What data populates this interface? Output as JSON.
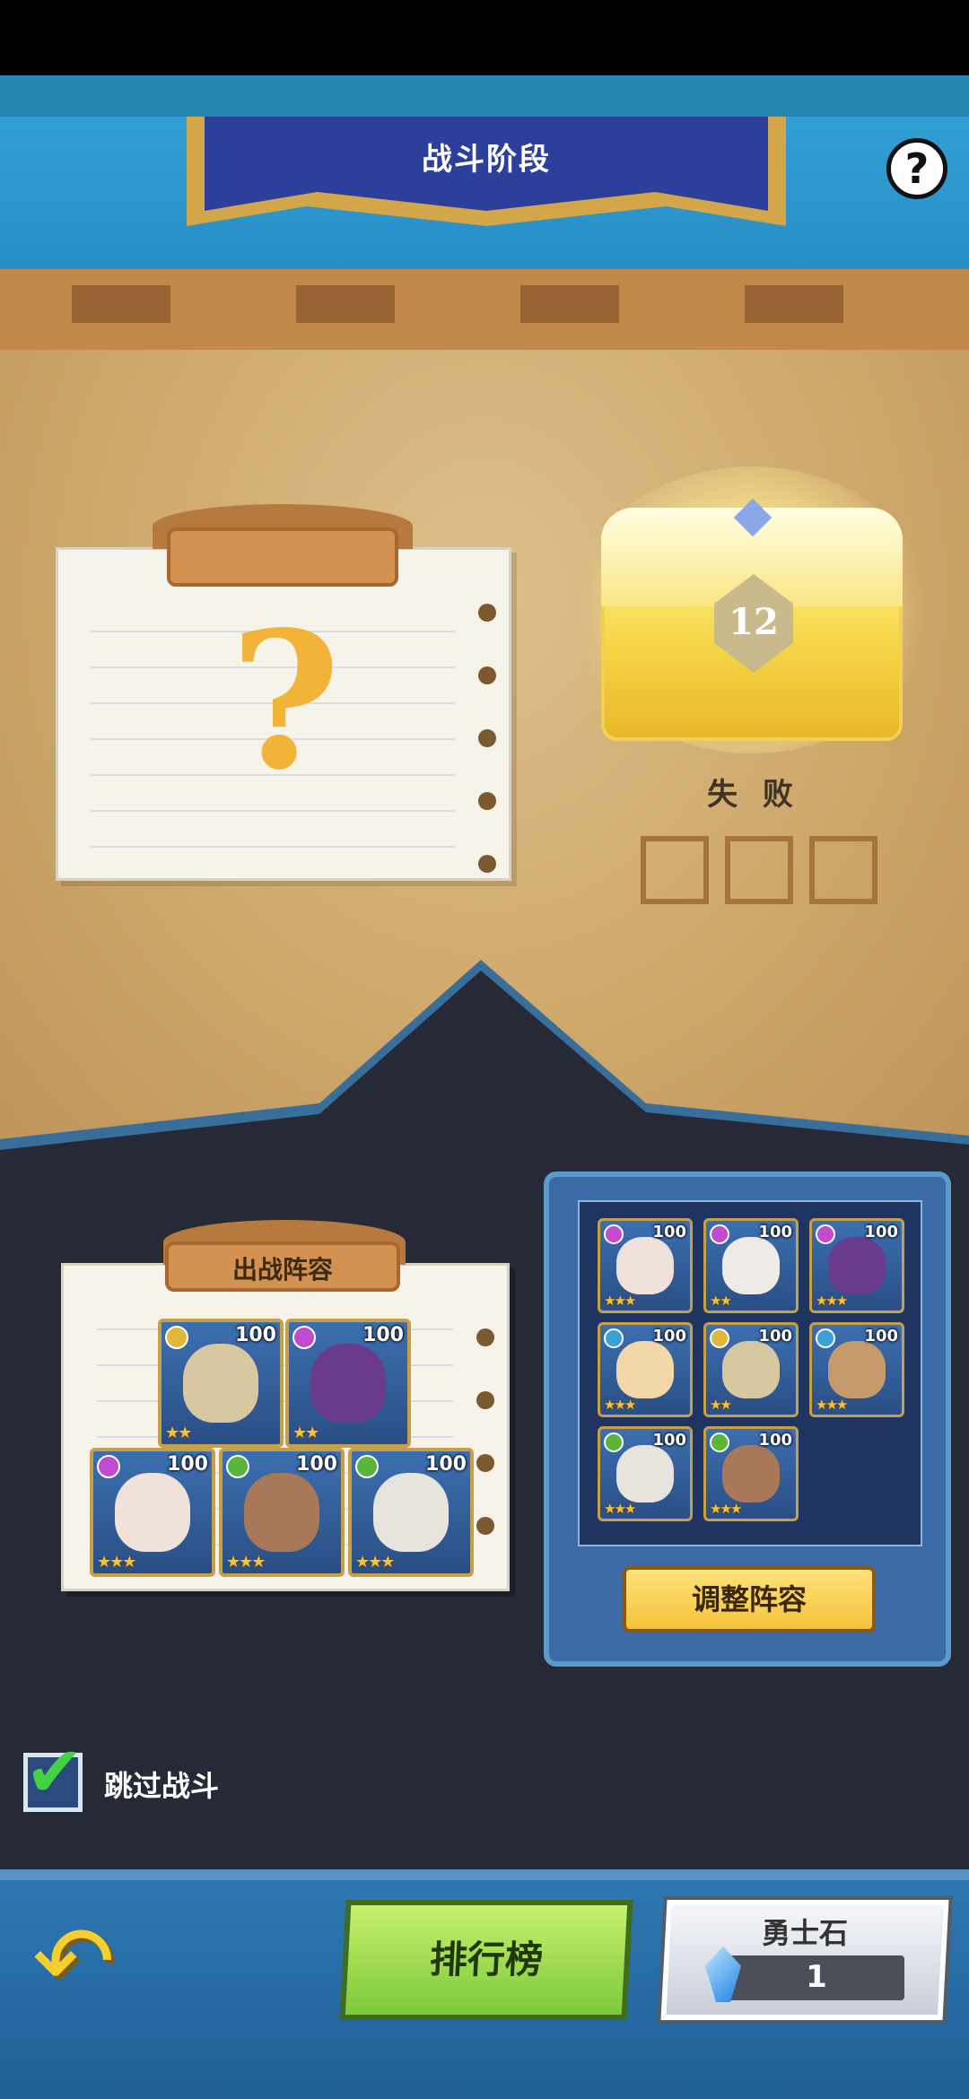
{
  "header": {
    "title": "战斗阶段",
    "help_icon": "question-icon"
  },
  "challenge": {
    "unknown_icon": "question-mark",
    "mark": "?"
  },
  "reward": {
    "chest_number": "12",
    "status": "失 败",
    "attempts": [
      false,
      false,
      false
    ]
  },
  "lineup": {
    "label": "出战阵容",
    "top_row": [
      {
        "level": "100",
        "stars": "★★",
        "badge_color": "#e0b83a",
        "face": "#d8c8a2"
      },
      {
        "level": "100",
        "stars": "★★",
        "badge_color": "#c04ad0",
        "face": "#6a3b8c"
      }
    ],
    "bottom_row": [
      {
        "level": "100",
        "stars": "★★★",
        "badge_color": "#c04ad0",
        "face": "#f1e1db"
      },
      {
        "level": "100",
        "stars": "★★★",
        "badge_color": "#5ab53a",
        "face": "#a9775a"
      },
      {
        "level": "100",
        "stars": "★★★",
        "badge_color": "#5ab53a",
        "face": "#e7e3dd"
      }
    ]
  },
  "roster": {
    "heroes": [
      {
        "level": "100",
        "stars": "★★★",
        "badge_color": "#c04ad0",
        "face": "#f1e1db"
      },
      {
        "level": "100",
        "stars": "★★",
        "badge_color": "#c04ad0",
        "face": "#eeeae6"
      },
      {
        "level": "100",
        "stars": "★★★",
        "badge_color": "#c04ad0",
        "face": "#6a3b8c"
      },
      {
        "level": "100",
        "stars": "★★★",
        "badge_color": "#3aa0d8",
        "face": "#f2d7a8"
      },
      {
        "level": "100",
        "stars": "★★",
        "badge_color": "#e0b83a",
        "face": "#d8c8a2"
      },
      {
        "level": "100",
        "stars": "★★★",
        "badge_color": "#3aa0d8",
        "face": "#c59a6d"
      },
      {
        "level": "100",
        "stars": "★★★",
        "badge_color": "#5ab53a",
        "face": "#e7e3dd"
      },
      {
        "level": "100",
        "stars": "★★★",
        "badge_color": "#5ab53a",
        "face": "#a9775a"
      }
    ],
    "adjust_label": "调整阵容"
  },
  "skip": {
    "label": "跳过战斗",
    "checked": true
  },
  "footer": {
    "back_icon": "back-arrow-icon",
    "leaderboard_label": "排行榜",
    "currency_title": "勇士石",
    "currency_value": "1",
    "currency_icon": "blue-crystal-icon"
  }
}
